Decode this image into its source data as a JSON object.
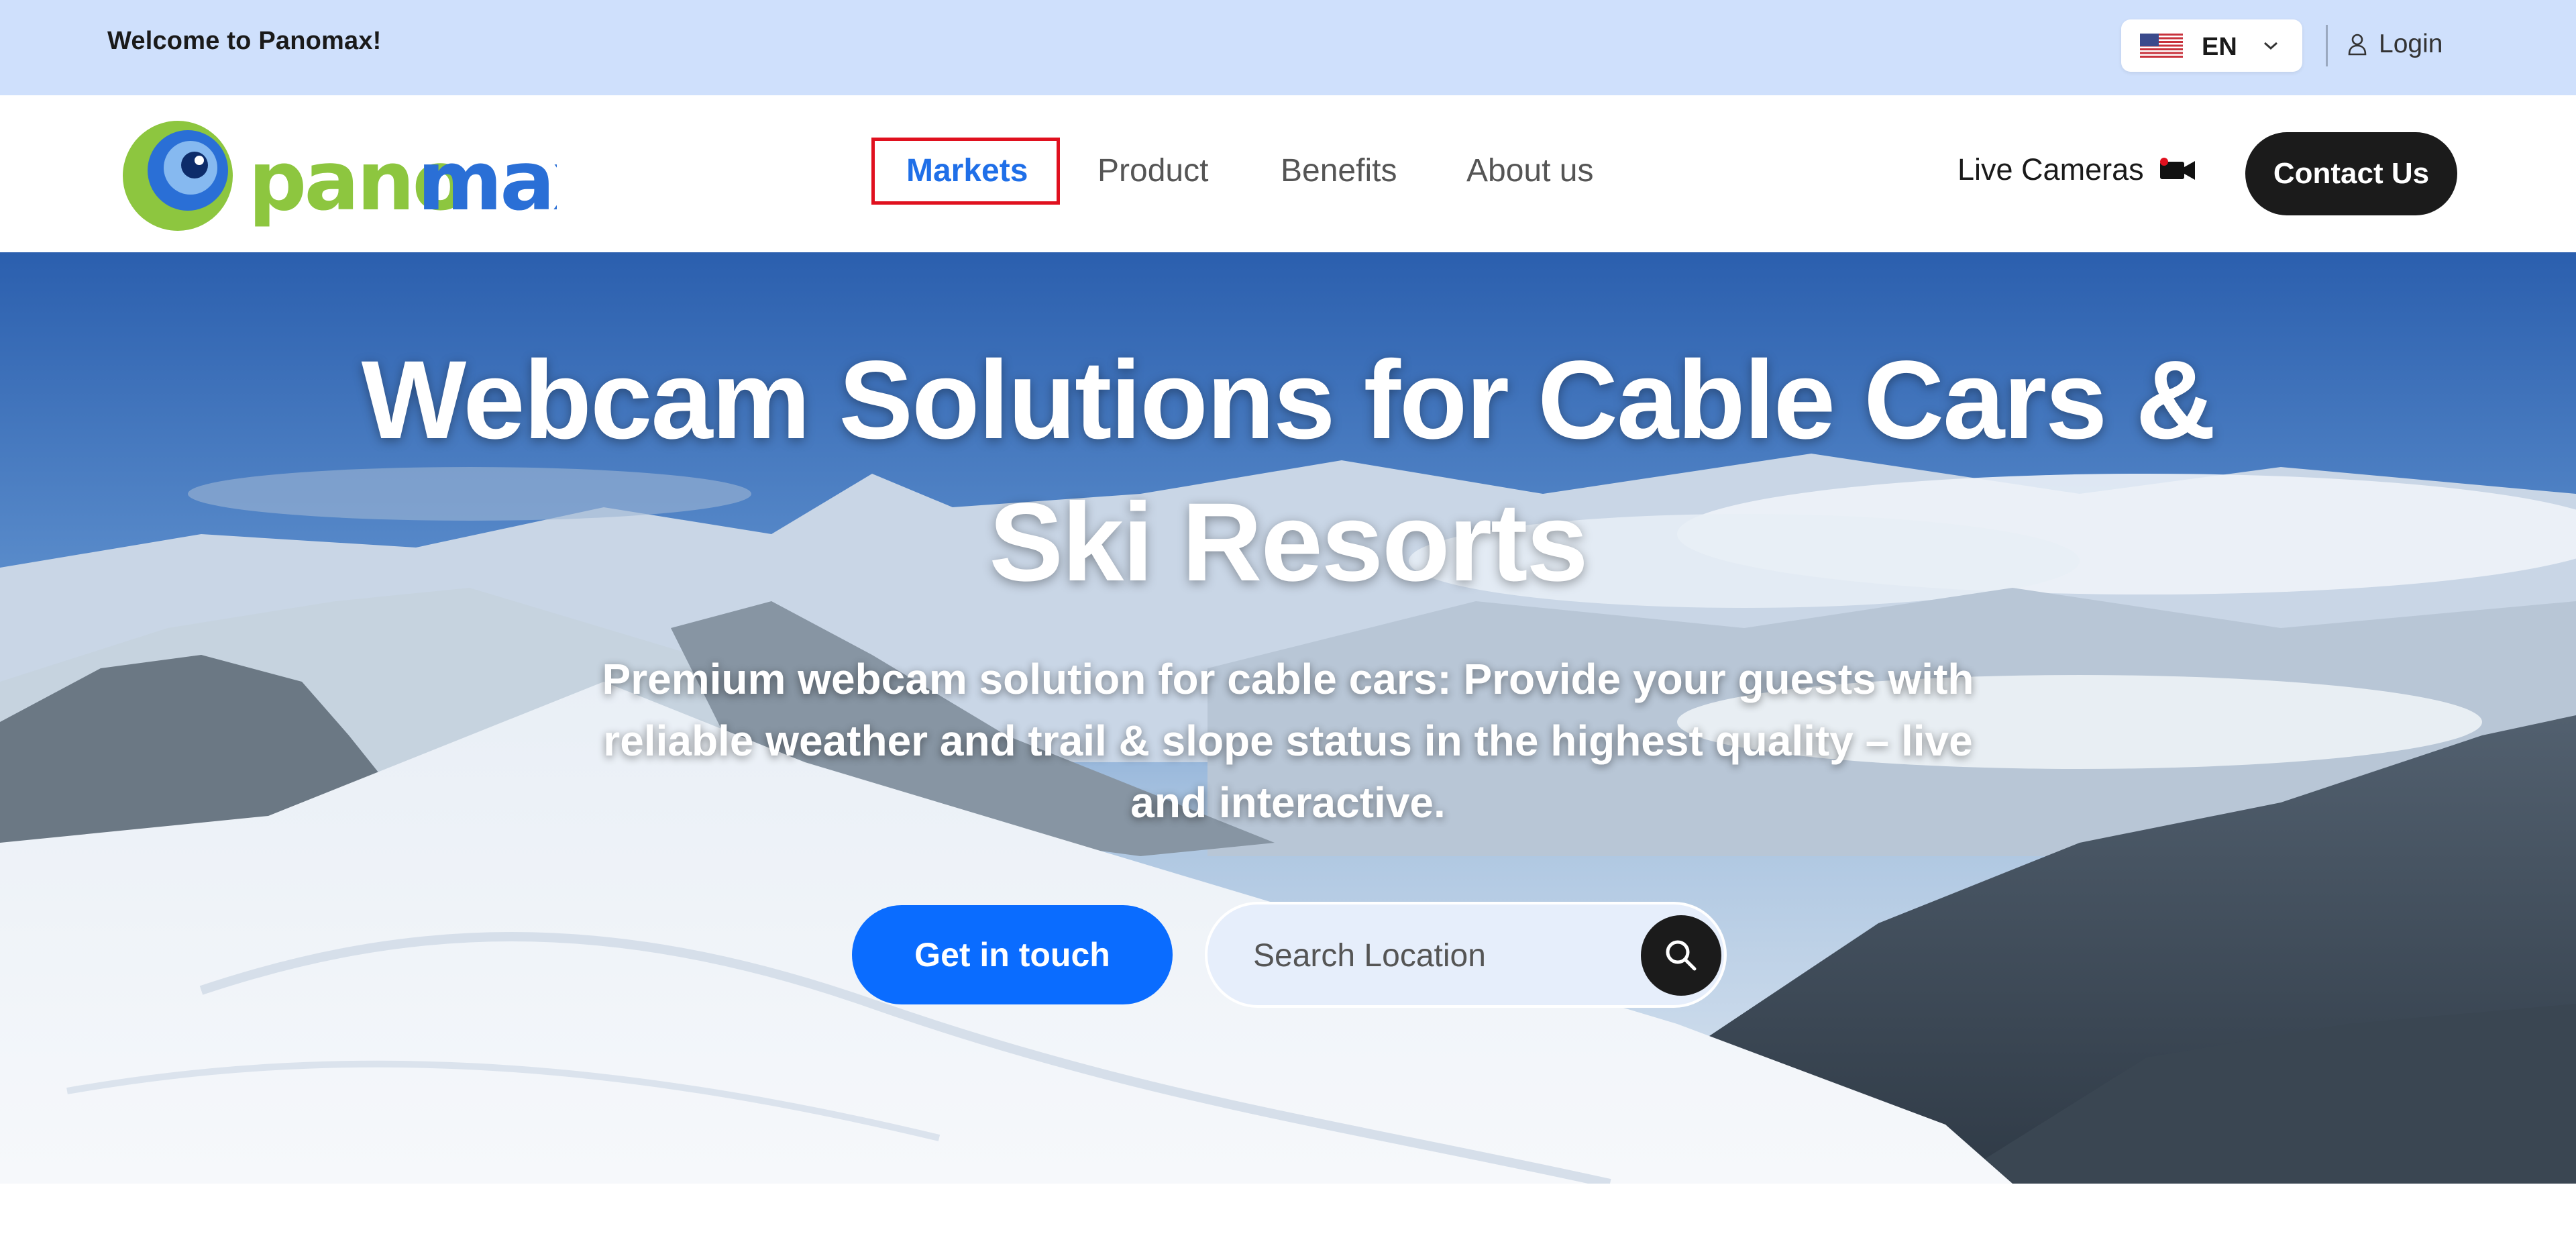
{
  "topbar": {
    "welcome": "Welcome to Panomax!",
    "language": {
      "code": "EN",
      "flag_icon": "us-flag-icon"
    },
    "login_label": "Login"
  },
  "header": {
    "logo_text": "panomax",
    "nav": [
      {
        "label": "Markets",
        "active": true
      },
      {
        "label": "Product",
        "active": false
      },
      {
        "label": "Benefits",
        "active": false
      },
      {
        "label": "About us",
        "active": false
      }
    ],
    "live_cameras_label": "Live Cameras",
    "contact_label": "Contact Us"
  },
  "hero": {
    "title_line1": "Webcam Solutions for Cable Cars &",
    "title_line2": "Ski Resorts",
    "subtitle_line1": "Premium webcam solution for cable cars: Provide your guests with",
    "subtitle_line2": "reliable weather and trail & slope status in the highest quality – live",
    "subtitle_line3": "and interactive.",
    "cta_label": "Get in touch",
    "search_placeholder": "Search Location"
  },
  "colors": {
    "topbar_bg": "#cfe0fc",
    "nav_active": "#1f6fe8",
    "highlight_border": "#e0101e",
    "cta_blue": "#0a6cff",
    "dark_button": "#1b1b1b",
    "logo_green": "#8dc63f",
    "logo_blue": "#2a6fd6"
  }
}
